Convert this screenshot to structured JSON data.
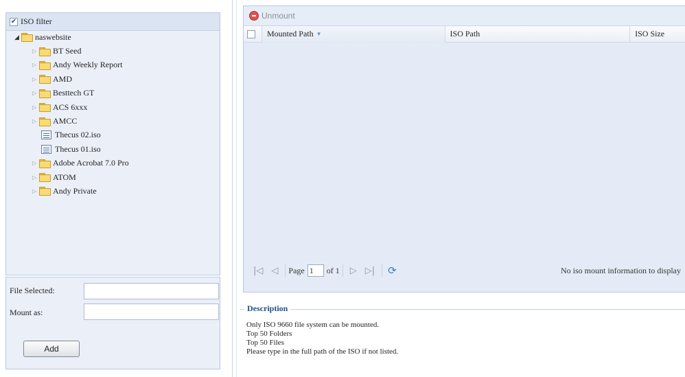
{
  "tree": {
    "filter_label": "ISO filter",
    "filter_checked": true,
    "root": "naswebsite",
    "items": [
      {
        "type": "folder",
        "label": "BT Seed"
      },
      {
        "type": "folder",
        "label": "Andy Weekly Report"
      },
      {
        "type": "folder",
        "label": "AMD"
      },
      {
        "type": "folder",
        "label": "Besttech GT"
      },
      {
        "type": "folder",
        "label": "ACS 6xxx"
      },
      {
        "type": "folder",
        "label": "AMCC"
      },
      {
        "type": "file",
        "label": "Thecus 02.iso"
      },
      {
        "type": "file",
        "label": "Thecus 01.iso"
      },
      {
        "type": "folder",
        "label": "Adobe Acrobat 7.0 Pro"
      },
      {
        "type": "folder",
        "label": "ATOM"
      },
      {
        "type": "folder",
        "label": "Andy Private"
      }
    ]
  },
  "form": {
    "file_selected_label": "File Selected:",
    "file_selected_value": "",
    "mount_as_label": "Mount as:",
    "mount_as_value": "",
    "add_label": "Add"
  },
  "grid": {
    "unmount_label": "Unmount",
    "columns": {
      "mounted_path": "Mounted Path",
      "iso_path": "ISO Path",
      "iso_size": "ISO Size"
    },
    "paging": {
      "page_label": "Page",
      "page_value": "1",
      "of_label": "of 1",
      "info": "No iso mount information to display"
    }
  },
  "description": {
    "legend": "Description",
    "lines": [
      "Only ISO 9660 file system can be mounted.",
      "Top 50 Folders",
      "Top 50 Files",
      "Please type in the full path of the ISO if not listed."
    ]
  },
  "icons": {
    "folder": "folder-icon",
    "file": "iso-file-icon",
    "unmount": "minus-circle-icon",
    "refresh": "refresh-icon"
  },
  "colors": {
    "panel_bg": "#ebeff8",
    "border": "#b8c7de",
    "legend_text": "#1f4f8d",
    "unmount_icon": "#e05252"
  }
}
